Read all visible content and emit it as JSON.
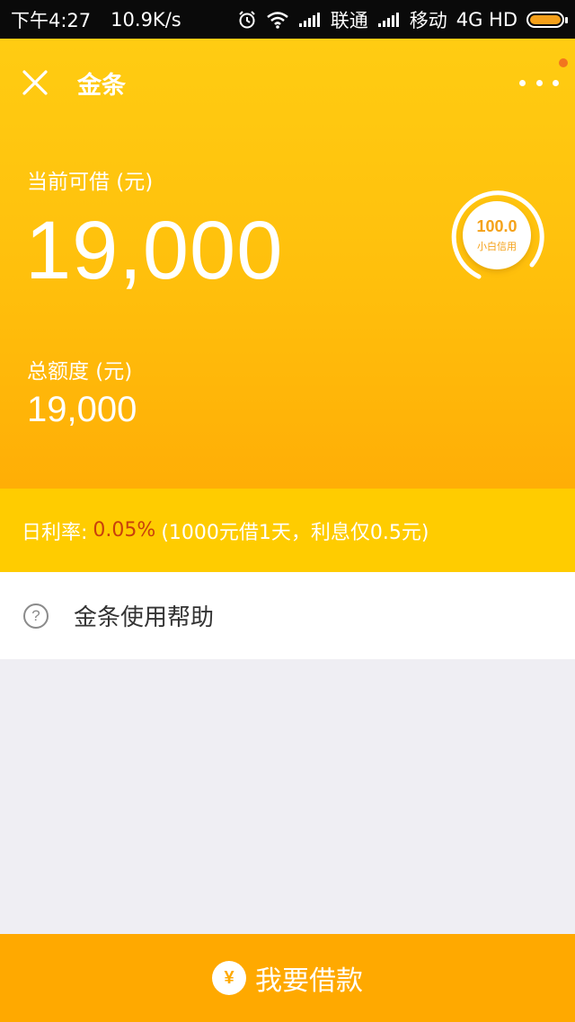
{
  "status_bar": {
    "time": "下午4:27",
    "net_speed": "10.9K/s",
    "carrier1": "联通",
    "carrier2": "移动",
    "network": "4G HD",
    "icons": [
      "alarm-icon",
      "wifi-icon",
      "signal-icon",
      "signal-icon",
      "battery-icon"
    ]
  },
  "nav": {
    "close_icon": "close-icon",
    "title": "金条",
    "more_icon": "more-icon"
  },
  "credit": {
    "available_label": "当前可借 (元)",
    "available_amount": "19,000",
    "total_label": "总额度 (元)",
    "total_amount": "19,000",
    "score_value": "100.0",
    "score_label": "小白信用"
  },
  "rate": {
    "prefix": "日利率:",
    "value": "0.05%",
    "note": "(1000元借1天，利息仅0.5元)"
  },
  "help": {
    "icon": "question-icon",
    "label": "金条使用帮助"
  },
  "action": {
    "icon_glyph": "¥",
    "label": "我要借款"
  },
  "colors": {
    "brand_yellow": "#ffc410",
    "rate_strip": "#ffcc00",
    "button": "#ffa900",
    "rate_value": "#c8400c",
    "score_text": "#f5a21a"
  }
}
